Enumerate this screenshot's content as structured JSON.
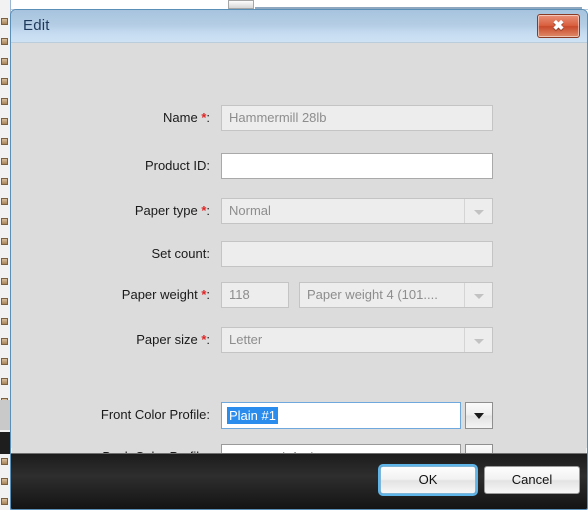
{
  "dialog": {
    "title": "Edit",
    "close_icon": "close-x-icon"
  },
  "form": {
    "rows": [
      {
        "label": "Name",
        "required": true,
        "colon": ":",
        "control": "text",
        "value": "Hammermill 28lb",
        "enabled": false
      },
      {
        "label": "Product ID",
        "required": false,
        "colon": ":",
        "control": "text",
        "value": "",
        "enabled": true
      },
      {
        "label": "Paper type",
        "required": true,
        "colon": ":",
        "control": "combo",
        "value": "Normal",
        "enabled": false
      },
      {
        "label": "Set count",
        "required": false,
        "colon": ":",
        "control": "text",
        "value": "",
        "enabled": false
      },
      {
        "label": "Paper weight",
        "required": true,
        "colon": ":",
        "control": "text-plus-combo",
        "value": "118",
        "combo_value": "Paper weight 4 (101....",
        "enabled": false
      },
      {
        "label": "Paper size",
        "required": true,
        "colon": ":",
        "control": "combo",
        "value": "Letter",
        "enabled": false
      }
    ],
    "profiles": [
      {
        "label": "Front Color Profile",
        "colon": ":",
        "value": "Plain #1",
        "selected": true
      },
      {
        "label": "Back Color Profile",
        "colon": ":",
        "value": "Server's default",
        "selected": false
      }
    ]
  },
  "footer": {
    "ok_label": "OK",
    "cancel_label": "Cancel"
  },
  "colors": {
    "titlebar_blue": "#b4cde4",
    "selection_blue": "#2a8ced",
    "required_red": "#e02424",
    "close_red": "#d9603f",
    "footer_dark": "#1c1c1c"
  }
}
